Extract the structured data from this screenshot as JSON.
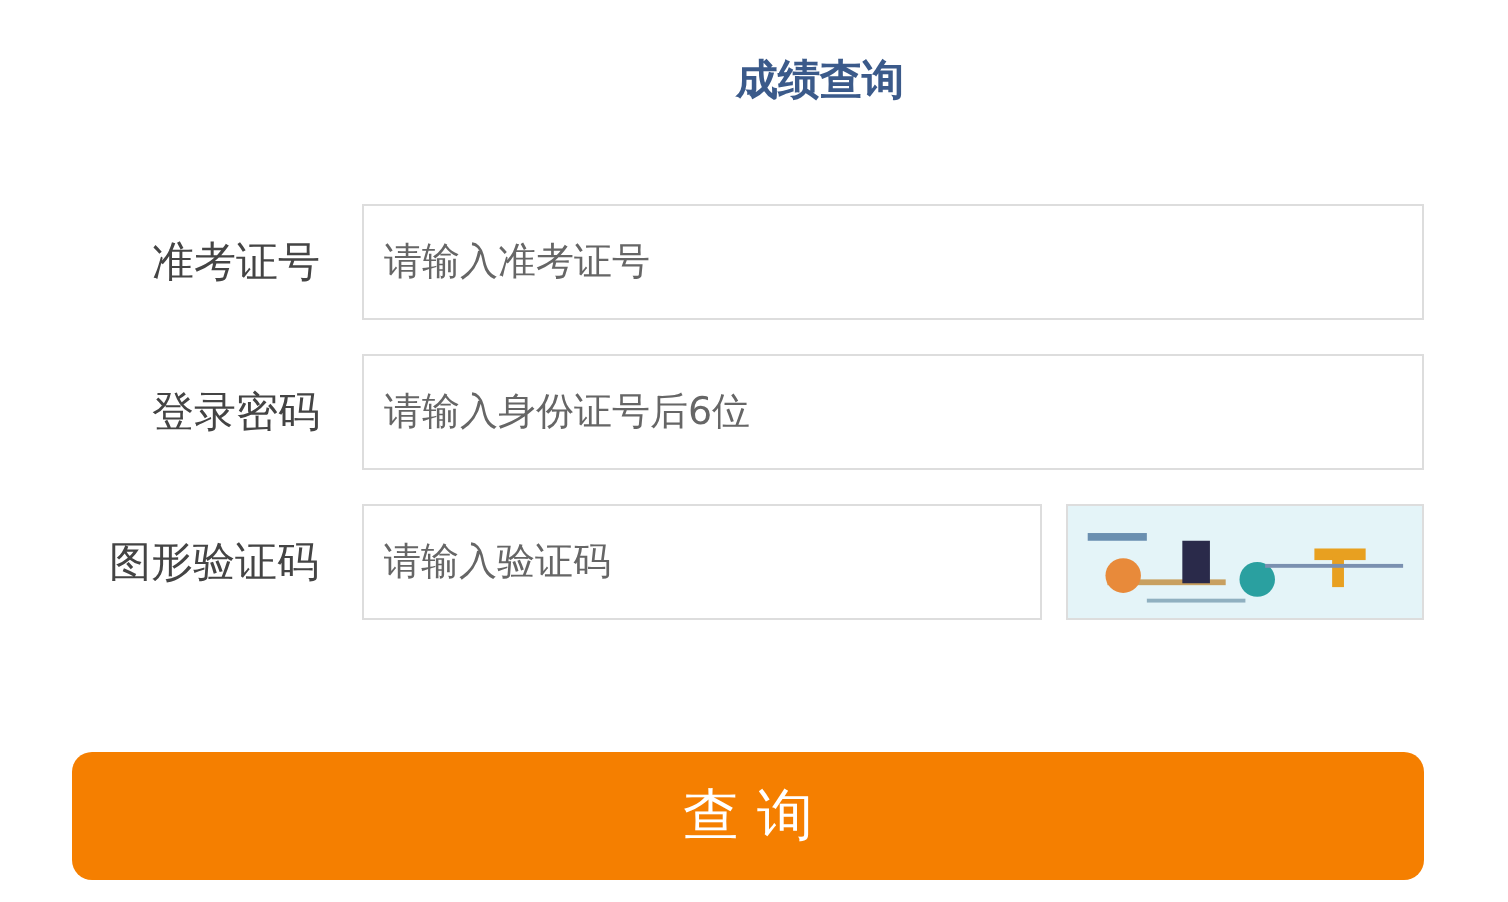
{
  "title": "成绩查询",
  "fields": [
    {
      "label": "准考证号",
      "placeholder": "请输入准考证号",
      "kind": "text"
    },
    {
      "label": "登录密码",
      "placeholder": "请输入身份证号后6位",
      "kind": "text"
    },
    {
      "label": "图形验证码",
      "placeholder": "请输入验证码",
      "kind": "captcha"
    }
  ],
  "submit": "查 询"
}
